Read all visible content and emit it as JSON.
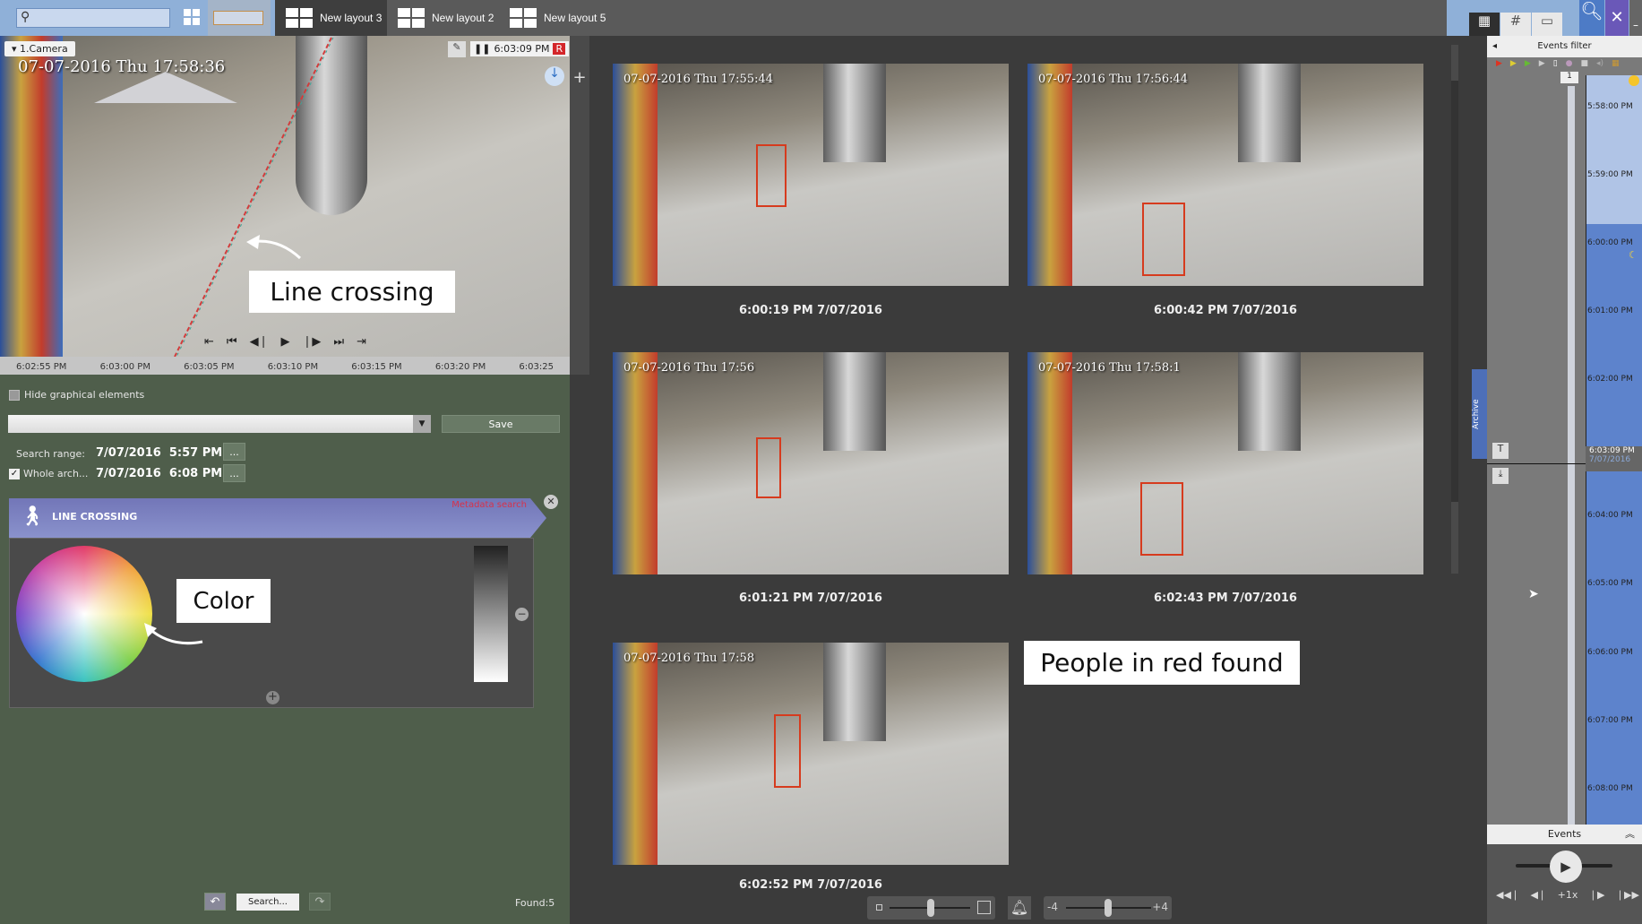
{
  "topbar": {
    "search_placeholder": "",
    "tabs": [
      {
        "label": "New layout 3",
        "active": true
      },
      {
        "label": "New layout 2"
      },
      {
        "label": "New layout 5"
      }
    ]
  },
  "camera": {
    "name": "1.Camera",
    "osd_timestamp": "07-07-2016 Thu 17:58:36",
    "playback_time": "6:03:09 PM",
    "record_badge": "R",
    "callout": "Line crossing"
  },
  "timeline": {
    "ticks": [
      "6:02:55 PM",
      "6:03:00 PM",
      "6:03:05 PM",
      "6:03:10 PM",
      "6:03:15 PM",
      "6:03:20 PM",
      "6:03:25"
    ]
  },
  "search_panel": {
    "hide_graphical": "Hide graphical elements",
    "save": "Save",
    "search_range_label": "Search range:",
    "range_start": "7/07/2016  5:57 PM",
    "whole_archive_label": "Whole arch...",
    "range_end": "7/07/2016  6:08 PM",
    "more": "...",
    "condition_title": "LINE CROSSING",
    "metadata_search": "Metadata search",
    "color_callout": "Color",
    "search_button": "Search...",
    "found": "Found:5"
  },
  "results": [
    {
      "osd": "07-07-2016 Thu 17:55:44",
      "caption": "6:00:19 PM 7/07/2016"
    },
    {
      "osd": "07-07-2016 Thu 17:56:44",
      "caption": "6:00:42 PM 7/07/2016"
    },
    {
      "osd": "07-07-2016 Thu 17:56",
      "caption": "6:01:21 PM 7/07/2016"
    },
    {
      "osd": "07-07-2016 Thu 17:58:1",
      "caption": "6:02:43 PM 7/07/2016"
    },
    {
      "osd": "07-07-2016 Thu 17:58",
      "caption": "6:02:52 PM 7/07/2016"
    }
  ],
  "results_callout": "People in red found",
  "bottom_controls": {
    "minus": "-4",
    "plus": "+4"
  },
  "right_panel": {
    "title": "Events filter",
    "archive_tab": "Archive",
    "counter": "1",
    "times": [
      "5:58:00 PM",
      "5:59:00 PM",
      "6:00:00 PM",
      "6:01:00 PM",
      "6:02:00 PM",
      "6:03:09 PM",
      "6:04:00 PM",
      "6:05:00 PM",
      "6:06:00 PM",
      "6:07:00 PM",
      "6:08:00 PM"
    ],
    "current_date": "7/07/2016",
    "events_label": "Events",
    "speed": "+1x"
  },
  "colors": {
    "accent": "#7b84c4",
    "record": "#d4262a",
    "highlight": "#d63b1e",
    "panel_green": "#4f5e4b"
  }
}
